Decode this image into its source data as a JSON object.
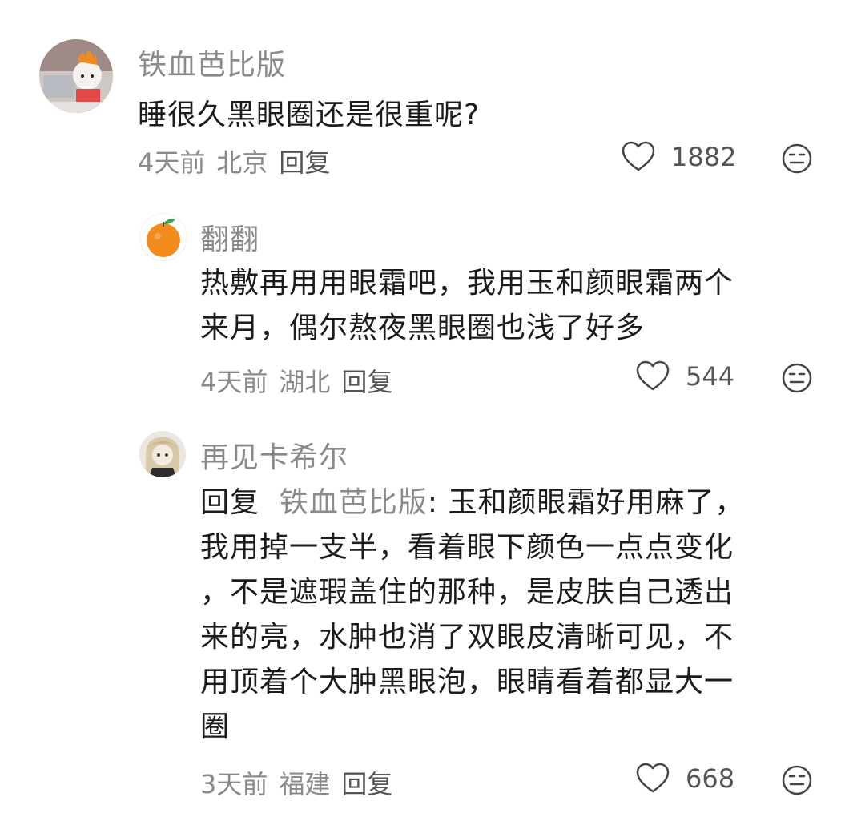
{
  "comments": [
    {
      "user": "铁血芭比版",
      "text": "睡很久黑眼圈还是很重呢?",
      "time": "4天前",
      "location": "北京",
      "reply_label": "回复",
      "likes": "1882",
      "avatar_icon": "hello-kitty-avatar-icon"
    },
    {
      "user": "翻翻",
      "text_lines": [
        "热敷再用用眼霜吧，我用玉和颜眼霜两个",
        "来月，偶尔熬夜黑眼圈也浅了好多"
      ],
      "time": "4天前",
      "location": "湖北",
      "reply_label": "回复",
      "likes": "544",
      "avatar_icon": "orange-fruit-avatar-icon"
    },
    {
      "user": "再见卡希尔",
      "reply_prefix": "回复",
      "reply_target": "铁血芭比版",
      "reply_text_first": ": 玉和颜眼霜好用麻了，",
      "text_lines": [
        "我用掉一支半，看着眼下颜色一点点变化",
        "，不是遮瑕盖住的那种，是皮肤自己透出",
        "来的亮，水肿也消了双眼皮清晰可见，不",
        "用顶着个大肿黑眼泡，眼睛看着都显大一",
        "圈"
      ],
      "time": "3天前",
      "location": "福建",
      "reply_label": "回复",
      "likes": "668",
      "avatar_icon": "anime-girl-avatar-icon"
    }
  ],
  "icons": {
    "like": "heart-outline-icon",
    "reaction": "neutral-face-icon"
  },
  "colors": {
    "name": "#8a8a8a",
    "text": "#1c1c1c",
    "meta": "#8a8a8a"
  }
}
